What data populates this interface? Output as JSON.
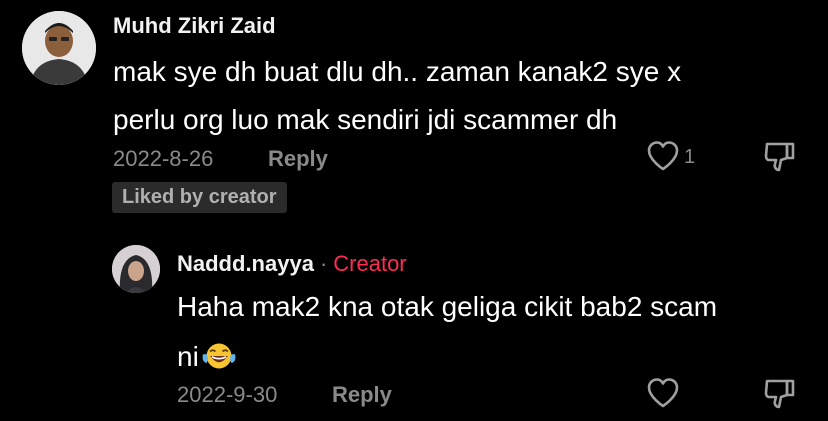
{
  "comments": [
    {
      "username": "Muhd Zikri Zaid",
      "text_line1": "mak sye dh buat dlu dh.. zaman kanak2 sye x",
      "text_line2": "perlu org luo mak sendiri jdi scammer dh",
      "date": "2022-8-26",
      "reply_label": "Reply",
      "like_count": "1",
      "badge": "Liked by creator"
    }
  ],
  "reply": {
    "username": "Naddd.nayya",
    "separator": "·",
    "creator_label": "Creator",
    "text_line1": "Haha mak2 kna otak geliga cikit bab2 scam",
    "text_line2": "ni",
    "emoji": "laughing-with-tears-emoji",
    "date": "2022-9-30",
    "reply_label": "Reply"
  },
  "colors": {
    "background": "#000000",
    "creator_accent": "#fe2c55",
    "muted_text": "#8a8a8a",
    "badge_bg": "#2b2b2b"
  }
}
